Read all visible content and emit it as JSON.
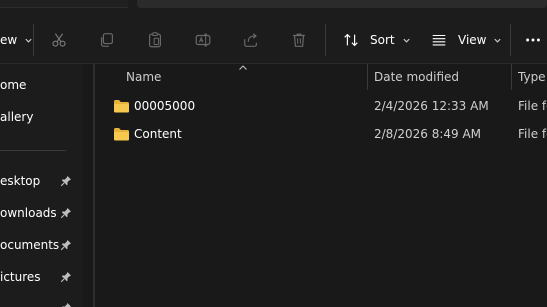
{
  "toolbar": {
    "view_menu_partial": "ew",
    "sort_label": "Sort",
    "view_label": "View",
    "icons": [
      "cut-icon",
      "copy-icon",
      "paste-icon",
      "rename-icon",
      "share-icon",
      "delete-icon",
      "sort-icon",
      "view-icon",
      "more-icon"
    ]
  },
  "nav": {
    "items": [
      {
        "label": "ome",
        "pinned": false
      },
      {
        "label": "allery",
        "pinned": false
      },
      {
        "label": "esktop",
        "pinned": true
      },
      {
        "label": "ownloads",
        "pinned": true
      },
      {
        "label": "ocuments",
        "pinned": true
      },
      {
        "label": "ictures",
        "pinned": true
      }
    ]
  },
  "columns": {
    "name": "Name",
    "date": "Date modified",
    "type": "Type"
  },
  "files": [
    {
      "name": "00005000",
      "date": "2/4/2026 12:33 AM",
      "type": "File fo"
    },
    {
      "name": "Content",
      "date": "2/8/2026 8:49 AM",
      "type": "File fo"
    }
  ],
  "colors": {
    "background": "#191919",
    "toolbar": "#1c1c1c",
    "folder": "#f0c24a"
  }
}
